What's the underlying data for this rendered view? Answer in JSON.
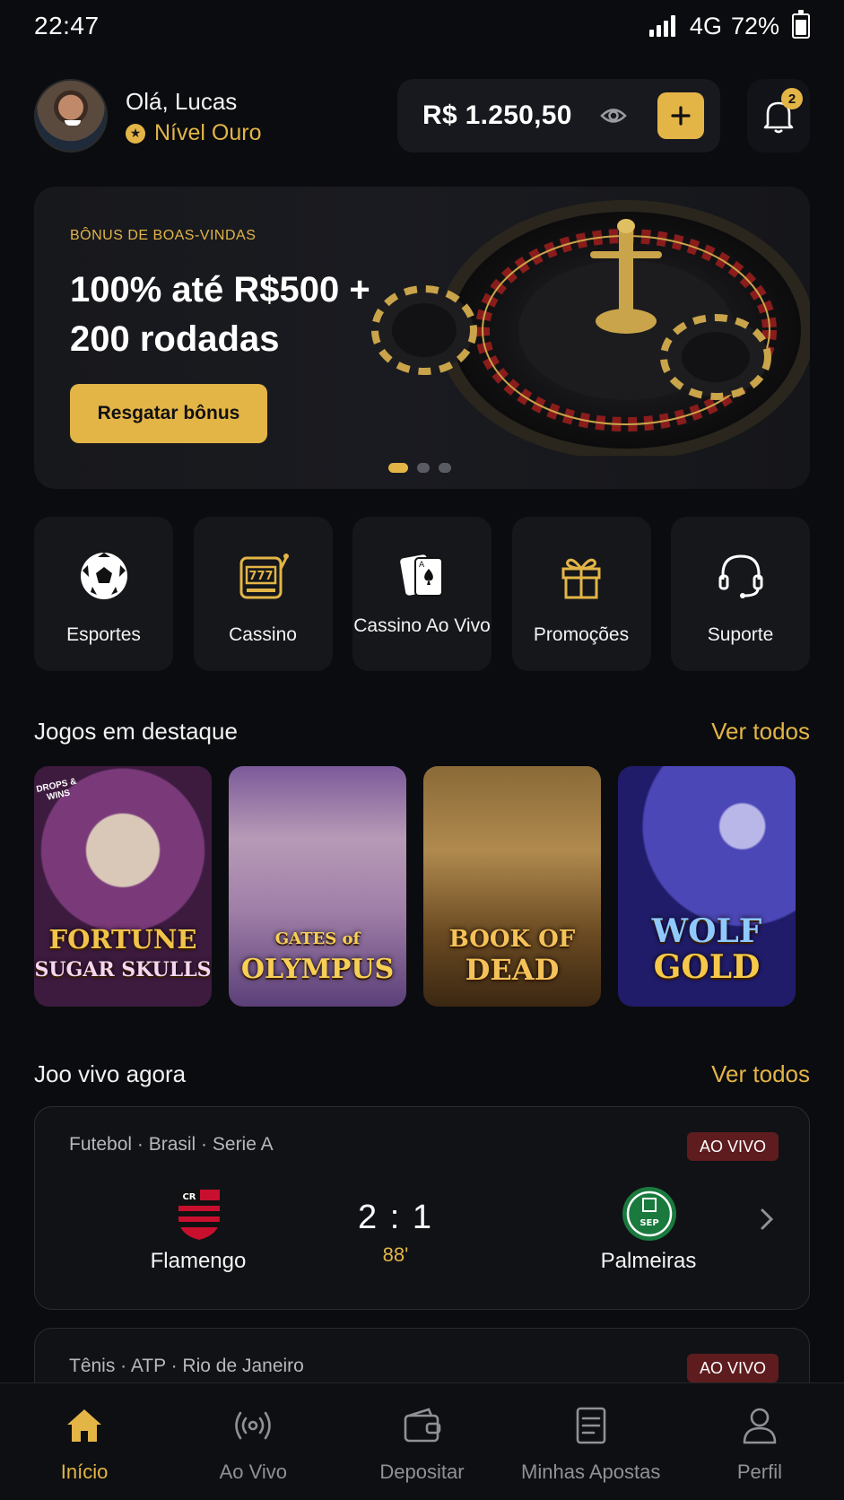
{
  "status_bar": {
    "time": "22:47",
    "network": "4G",
    "battery": "72%"
  },
  "header": {
    "greeting": "Olá, Lucas",
    "level": "Nível Ouro",
    "balance": "R$ 1.250,50",
    "notifications_count": "2"
  },
  "banner": {
    "eyebrow": "BÔNUS DE BOAS-VINDAS",
    "title": "100% até R$500 + 200 rodadas",
    "button": "Resgatar bônus",
    "slides": 3,
    "active_slide": 1
  },
  "categories": [
    {
      "label": "Esportes",
      "icon": "soccer-ball-icon"
    },
    {
      "label": "Cassino",
      "icon": "slot-machine-icon"
    },
    {
      "label": "Cassino Ao Vivo",
      "icon": "playing-cards-icon"
    },
    {
      "label": "Promoções",
      "icon": "gift-icon"
    },
    {
      "label": "Suporte",
      "icon": "headset-icon"
    }
  ],
  "featured": {
    "title": "Jogos em destaque",
    "see_all": "Ver todos",
    "games": [
      {
        "name": "FORTUNE SUGAR SKULLS",
        "line1": "FORTUNE",
        "line2": "SUGAR SKULLS",
        "badge": "DROPS & WINS"
      },
      {
        "name": "GATES of OLYMPUS",
        "line1": "GATES of",
        "line2": "OLYMPUS"
      },
      {
        "name": "BOOK OF DEAD",
        "line1": "BOOK OF",
        "line2": "DEAD"
      },
      {
        "name": "WOLF GOLD",
        "line1": "WOLF",
        "line2": "GOLD"
      }
    ]
  },
  "live": {
    "title": "Joo vivo agora",
    "see_all": "Ver todos",
    "matches": [
      {
        "league": "Futebol · Brasil · Serie A",
        "badge": "AO VIVO",
        "home": "Flamengo",
        "away": "Palmeiras",
        "score": "2 : 1",
        "minute": "88'"
      },
      {
        "league": "Tênis · ATP · Rio de Janeiro",
        "badge": "AO VIVO"
      }
    ]
  },
  "bottom_nav": [
    {
      "label": "Início",
      "icon": "home-icon",
      "active": true
    },
    {
      "label": "Ao Vivo",
      "icon": "broadcast-icon"
    },
    {
      "label": "Depositar",
      "icon": "wallet-icon"
    },
    {
      "label": "Minhas Apostas",
      "icon": "bets-ticket-icon"
    },
    {
      "label": "Perfil",
      "icon": "user-icon"
    }
  ],
  "colors": {
    "accent": "#e3b547",
    "background": "#0b0c0f",
    "card": "#15171b",
    "live_badge": "#5e1c1f"
  }
}
